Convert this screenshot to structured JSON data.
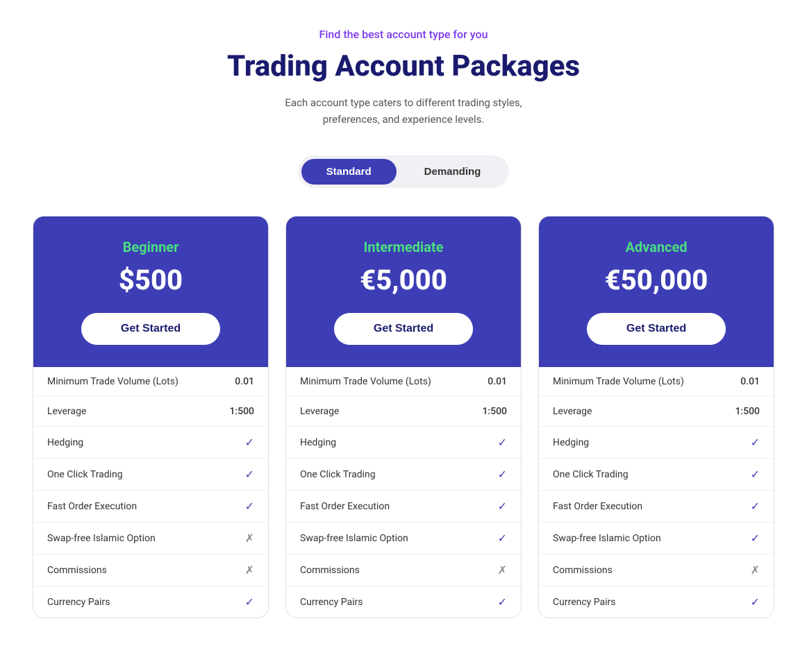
{
  "header": {
    "subtitle": "Find the best account type for you",
    "title": "Trading Account Packages",
    "description": "Each account type caters to different trading styles, preferences, and experience levels."
  },
  "tabs": [
    {
      "id": "standard",
      "label": "Standard",
      "active": true
    },
    {
      "id": "demanding",
      "label": "Demanding",
      "active": false
    }
  ],
  "cards": [
    {
      "id": "beginner",
      "tier": "Beginner",
      "tier_class": "beginner",
      "amount": "$500",
      "cta": "Get Started",
      "features": [
        {
          "label": "Minimum Trade Volume (Lots)",
          "value": "0.01",
          "type": "value"
        },
        {
          "label": "Leverage",
          "value": "1:500",
          "type": "value"
        },
        {
          "label": "Hedging",
          "value": "✓",
          "type": "check"
        },
        {
          "label": "One Click Trading",
          "value": "✓",
          "type": "check"
        },
        {
          "label": "Fast Order Execution",
          "value": "✓",
          "type": "check"
        },
        {
          "label": "Swap-free Islamic Option",
          "value": "✗",
          "type": "cross"
        },
        {
          "label": "Commissions",
          "value": "✗",
          "type": "cross"
        },
        {
          "label": "Currency Pairs",
          "value": "✓",
          "type": "check"
        }
      ]
    },
    {
      "id": "intermediate",
      "tier": "Intermediate",
      "tier_class": "intermediate",
      "amount": "€5,000",
      "cta": "Get Started",
      "features": [
        {
          "label": "Minimum Trade Volume (Lots)",
          "value": "0.01",
          "type": "value"
        },
        {
          "label": "Leverage",
          "value": "1:500",
          "type": "value"
        },
        {
          "label": "Hedging",
          "value": "✓",
          "type": "check"
        },
        {
          "label": "One Click Trading",
          "value": "✓",
          "type": "check"
        },
        {
          "label": "Fast Order Execution",
          "value": "✓",
          "type": "check"
        },
        {
          "label": "Swap-free Islamic Option",
          "value": "✓",
          "type": "check"
        },
        {
          "label": "Commissions",
          "value": "✗",
          "type": "cross"
        },
        {
          "label": "Currency Pairs",
          "value": "✓",
          "type": "check"
        }
      ]
    },
    {
      "id": "advanced",
      "tier": "Advanced",
      "tier_class": "advanced",
      "amount": "€50,000",
      "cta": "Get Started",
      "features": [
        {
          "label": "Minimum Trade Volume (Lots)",
          "value": "0.01",
          "type": "value"
        },
        {
          "label": "Leverage",
          "value": "1:500",
          "type": "value"
        },
        {
          "label": "Hedging",
          "value": "✓",
          "type": "check"
        },
        {
          "label": "One Click Trading",
          "value": "✓",
          "type": "check"
        },
        {
          "label": "Fast Order Execution",
          "value": "✓",
          "type": "check"
        },
        {
          "label": "Swap-free Islamic Option",
          "value": "✓",
          "type": "check"
        },
        {
          "label": "Commissions",
          "value": "✗",
          "type": "cross"
        },
        {
          "label": "Currency Pairs",
          "value": "✓",
          "type": "check"
        }
      ]
    }
  ]
}
